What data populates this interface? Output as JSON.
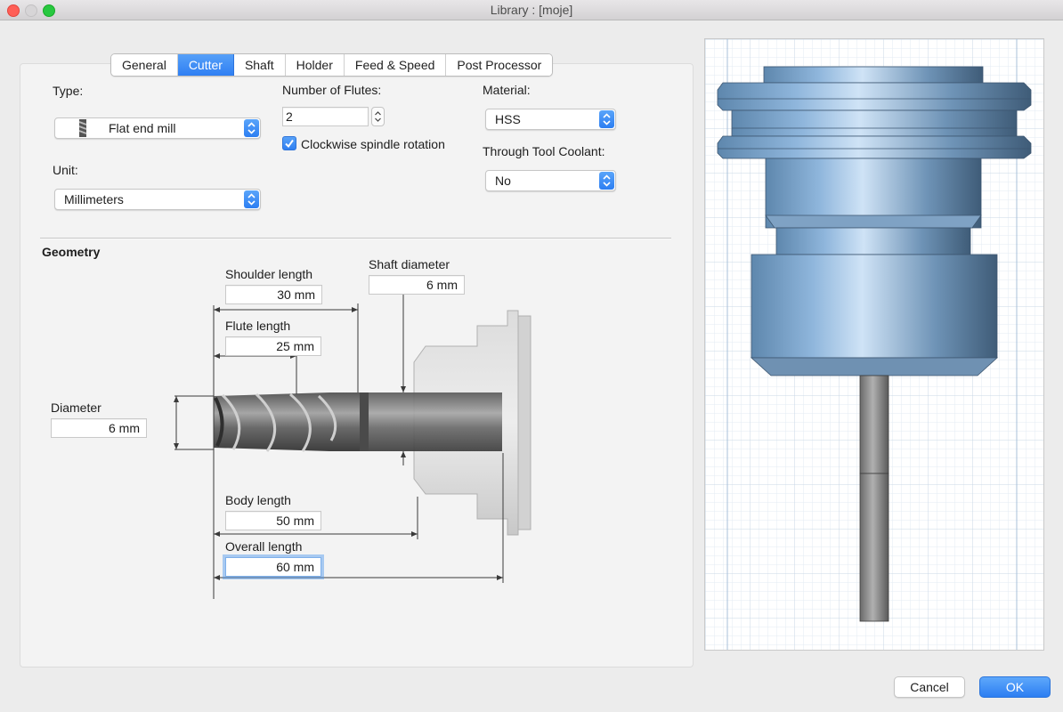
{
  "window": {
    "title": "Library : [moje]"
  },
  "tabs": [
    "General",
    "Cutter",
    "Shaft",
    "Holder",
    "Feed & Speed",
    "Post Processor"
  ],
  "active_tab": "Cutter",
  "form": {
    "type_label": "Type:",
    "type_value": "Flat end mill",
    "unit_label": "Unit:",
    "unit_value": "Millimeters",
    "flutes_label": "Number of Flutes:",
    "flutes_value": "2",
    "clockwise_label": "Clockwise spindle rotation",
    "clockwise_checked": true,
    "material_label": "Material:",
    "material_value": "HSS",
    "coolant_label": "Through Tool Coolant:",
    "coolant_value": "No"
  },
  "geometry": {
    "heading": "Geometry",
    "shoulder_length_label": "Shoulder length",
    "shoulder_length": "30 mm",
    "shaft_diameter_label": "Shaft diameter",
    "shaft_diameter": "6 mm",
    "flute_length_label": "Flute length",
    "flute_length": "25 mm",
    "diameter_label": "Diameter",
    "diameter": "6 mm",
    "body_length_label": "Body length",
    "body_length": "50 mm",
    "overall_length_label": "Overall length",
    "overall_length": "60 mm"
  },
  "buttons": {
    "cancel": "Cancel",
    "ok": "OK"
  },
  "colors": {
    "accent": "#3a8ef5",
    "holder": "#6f9bc4",
    "tool": "#6b6b6b"
  }
}
